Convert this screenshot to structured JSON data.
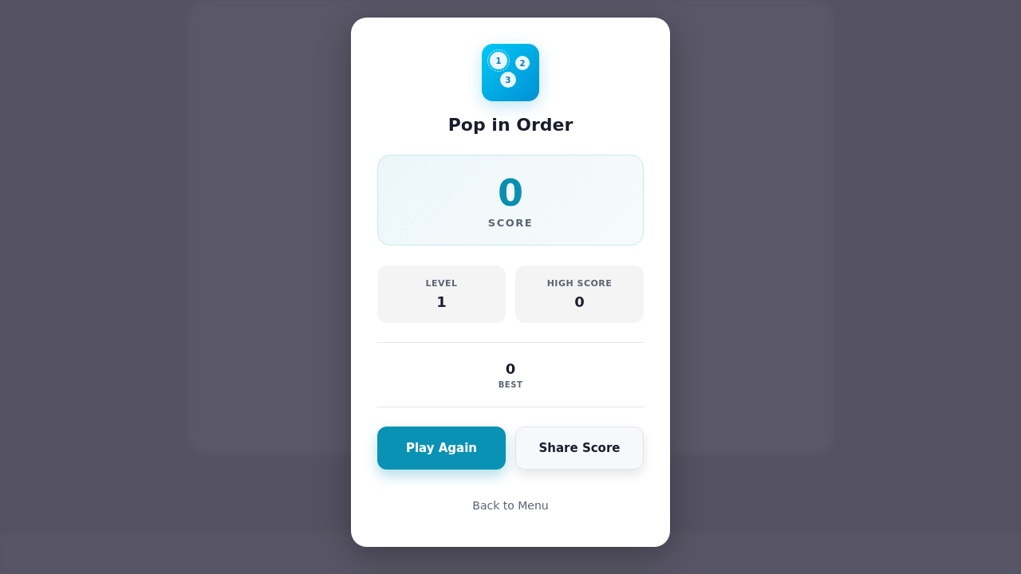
{
  "dialog": {
    "icon_bubbles": [
      "1",
      "2",
      "3"
    ],
    "title": "Pop in Order"
  },
  "score": {
    "value": "0",
    "label": "SCORE"
  },
  "stats": [
    {
      "label": "LEVEL",
      "value": "1"
    },
    {
      "label": "HIGH SCORE",
      "value": "0"
    }
  ],
  "best": {
    "value": "0",
    "label": "BEST"
  },
  "buttons": [
    {
      "label": "Play Again",
      "kind": "primary"
    },
    {
      "label": "Share Score",
      "kind": "secondary"
    }
  ],
  "link": "Back to Menu"
}
